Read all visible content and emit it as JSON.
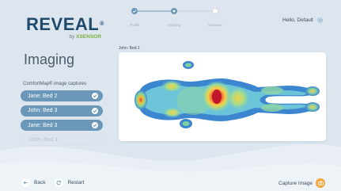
{
  "brand": {
    "name": "REVEAL",
    "mark": "®",
    "sub_prefix": "by ",
    "sub_highlight": "XSENSOR"
  },
  "steps": {
    "items": [
      {
        "label": "Profile",
        "state": "done"
      },
      {
        "label": "Imaging",
        "state": "current"
      },
      {
        "label": "Discover",
        "state": "pending"
      }
    ]
  },
  "header": {
    "greeting": "Hello, Default",
    "settings_icon": "gear-icon"
  },
  "page": {
    "title": "Imaging"
  },
  "captures": {
    "label": "ComfortMap® image captures",
    "items": [
      {
        "label": "Jane: Bed 2",
        "selected": true
      },
      {
        "label": "John: Bed 3",
        "selected": true
      },
      {
        "label": "Jane: Bed 3",
        "selected": true
      },
      {
        "label": "John: Bed 1",
        "selected": false
      }
    ]
  },
  "viewer": {
    "title": "John: Bed 1"
  },
  "footer": {
    "back": "Back",
    "restart": "Restart",
    "capture": "Capture Image"
  },
  "colors": {
    "accent": "#6b98b8",
    "brand": "#1f4a6b",
    "capture": "#f3a43a",
    "success": "#7ab23f"
  }
}
